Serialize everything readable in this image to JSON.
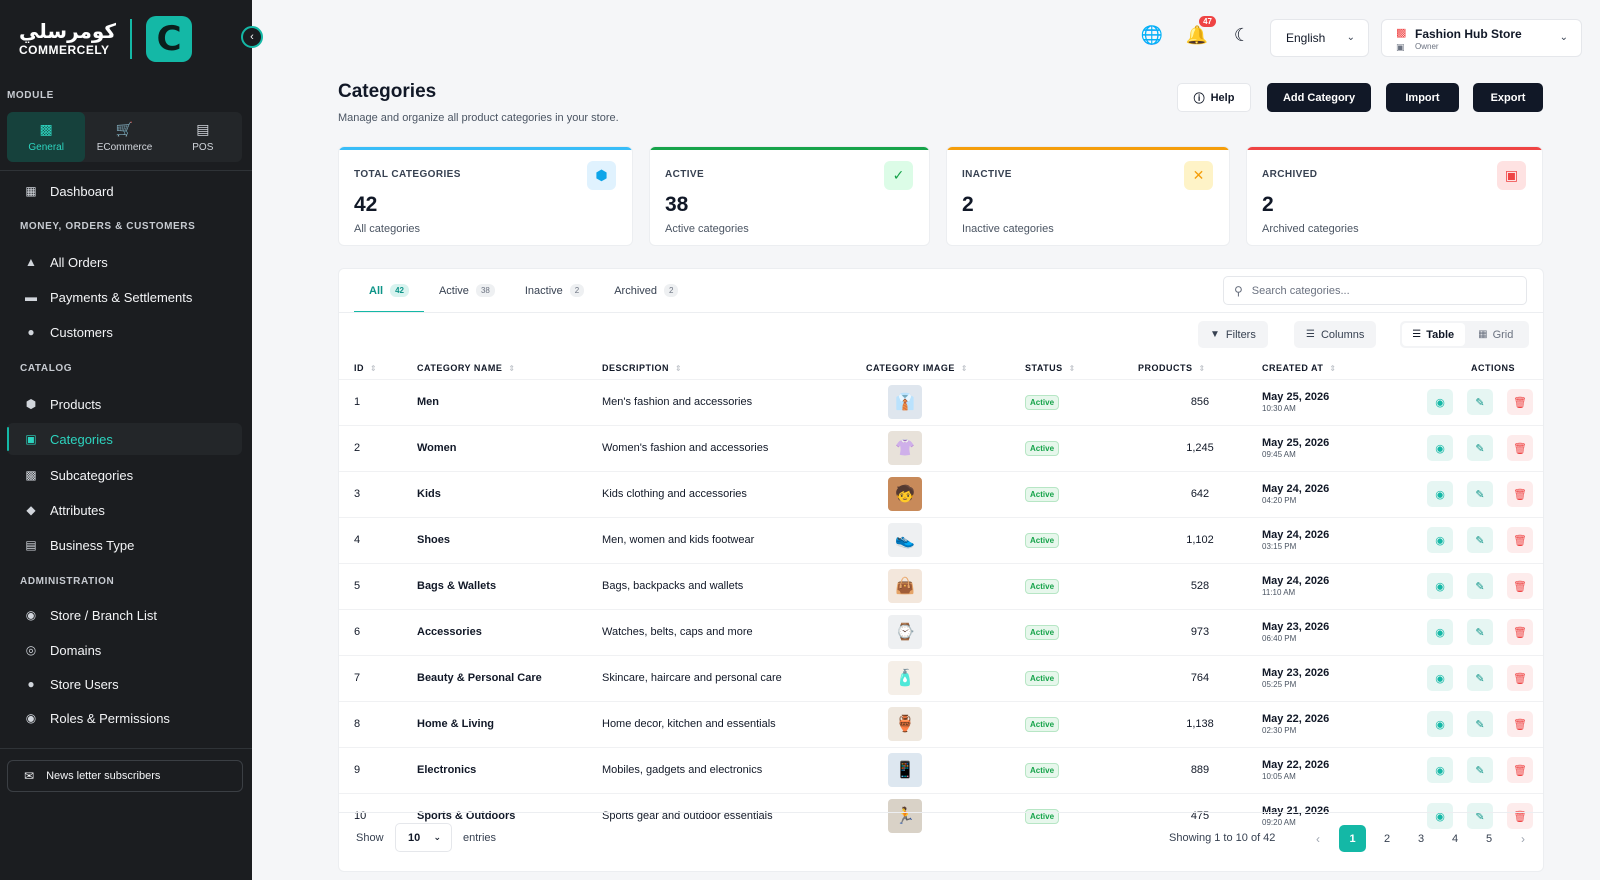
{
  "brand": {
    "arabic": "كومرسلي",
    "latin": "COMMERCELY",
    "mark": "C"
  },
  "sidebar": {
    "module_label": "MODULE",
    "modules": [
      {
        "label": "General",
        "icon": "user-badge-icon",
        "active": true
      },
      {
        "label": "ECommerce",
        "icon": "cart-icon",
        "active": false
      },
      {
        "label": "POS",
        "icon": "printer-icon",
        "active": false
      }
    ],
    "dashboard": "Dashboard",
    "sections": {
      "money": "MONEY, ORDERS & CUSTOMERS",
      "catalog": "CATALOG",
      "admin": "ADMINISTRATION"
    },
    "items": {
      "all_orders": "All Orders",
      "payments": "Payments & Settlements",
      "customers": "Customers",
      "products": "Products",
      "categories": "Categories",
      "subcategories": "Subcategories",
      "attributes": "Attributes",
      "business_type": "Business Type",
      "store_branch": "Store / Branch List",
      "domains": "Domains",
      "store_users": "Store Users",
      "roles": "Roles & Permissions"
    },
    "newsletter": "News letter subscribers"
  },
  "header": {
    "notifications_count": "47",
    "language": "English",
    "store_name": "Fashion Hub Store",
    "store_role": "Owner"
  },
  "page": {
    "title": "Categories",
    "subtitle": "Manage and organize all product categories in your store.",
    "help": "Help",
    "add": "Add Category",
    "import": "Import",
    "export": "Export"
  },
  "stats": [
    {
      "label": "TOTAL CATEGORIES",
      "value": "42",
      "sub": "All categories",
      "color": "#38bdf8"
    },
    {
      "label": "ACTIVE",
      "value": "38",
      "sub": "Active categories",
      "color": "#16a34a"
    },
    {
      "label": "INACTIVE",
      "value": "2",
      "sub": "Inactive categories",
      "color": "#f59e0b"
    },
    {
      "label": "ARCHIVED",
      "value": "2",
      "sub": "Archived categories",
      "color": "#ef4444"
    }
  ],
  "tabs": [
    {
      "label": "All",
      "count": "42"
    },
    {
      "label": "Active",
      "count": "38"
    },
    {
      "label": "Inactive",
      "count": "2"
    },
    {
      "label": "Archived",
      "count": "2"
    }
  ],
  "search_placeholder": "Search categories...",
  "toolbar": {
    "filters": "Filters",
    "columns": "Columns",
    "table": "Table",
    "grid": "Grid"
  },
  "columns": [
    "ID",
    "CATEGORY NAME",
    "DESCRIPTION",
    "CATEGORY IMAGE",
    "STATUS",
    "PRODUCTS",
    "CREATED AT",
    "ACTIONS"
  ],
  "rows": [
    {
      "id": "1",
      "name": "Men",
      "desc": "Men's fashion and accessories",
      "status": "Active",
      "products": "856",
      "date": "May 25, 2026",
      "time": "10:30 AM",
      "img": "👔",
      "bg": "#dfe6ee"
    },
    {
      "id": "2",
      "name": "Women",
      "desc": "Women's fashion and accessories",
      "status": "Active",
      "products": "1,245",
      "date": "May 25, 2026",
      "time": "09:45 AM",
      "img": "👚",
      "bg": "#e8e2da"
    },
    {
      "id": "3",
      "name": "Kids",
      "desc": "Kids clothing and accessories",
      "status": "Active",
      "products": "642",
      "date": "May 24, 2026",
      "time": "04:20 PM",
      "img": "🧒",
      "bg": "#c88a5a"
    },
    {
      "id": "4",
      "name": "Shoes",
      "desc": "Men, women and kids footwear",
      "status": "Active",
      "products": "1,102",
      "date": "May 24, 2026",
      "time": "03:15 PM",
      "img": "👟",
      "bg": "#eef0f2"
    },
    {
      "id": "5",
      "name": "Bags & Wallets",
      "desc": "Bags, backpacks and wallets",
      "status": "Active",
      "products": "528",
      "date": "May 24, 2026",
      "time": "11:10 AM",
      "img": "👜",
      "bg": "#f3e7dc"
    },
    {
      "id": "6",
      "name": "Accessories",
      "desc": "Watches, belts, caps and more",
      "status": "Active",
      "products": "973",
      "date": "May 23, 2026",
      "time": "06:40 PM",
      "img": "⌚",
      "bg": "#eef0f2"
    },
    {
      "id": "7",
      "name": "Beauty & Personal Care",
      "desc": "Skincare, haircare and personal care",
      "status": "Active",
      "products": "764",
      "date": "May 23, 2026",
      "time": "05:25 PM",
      "img": "🧴",
      "bg": "#f5efe8"
    },
    {
      "id": "8",
      "name": "Home & Living",
      "desc": "Home decor, kitchen and essentials",
      "status": "Active",
      "products": "1,138",
      "date": "May 22, 2026",
      "time": "02:30 PM",
      "img": "🏺",
      "bg": "#efe8df"
    },
    {
      "id": "9",
      "name": "Electronics",
      "desc": "Mobiles, gadgets and electronics",
      "status": "Active",
      "products": "889",
      "date": "May 22, 2026",
      "time": "10:05 AM",
      "img": "📱",
      "bg": "#dde7f0"
    },
    {
      "id": "10",
      "name": "Sports & Outdoors",
      "desc": "Sports gear and outdoor essentials",
      "status": "Active",
      "products": "475",
      "date": "May 21, 2026",
      "time": "09:20 AM",
      "img": "🏃",
      "bg": "#d9d2c7"
    }
  ],
  "footer": {
    "show": "Show",
    "entries_value": "10",
    "entries": "entries",
    "showing": "Showing 1 to 10 of 42",
    "pages": [
      "1",
      "2",
      "3",
      "4",
      "5"
    ]
  }
}
